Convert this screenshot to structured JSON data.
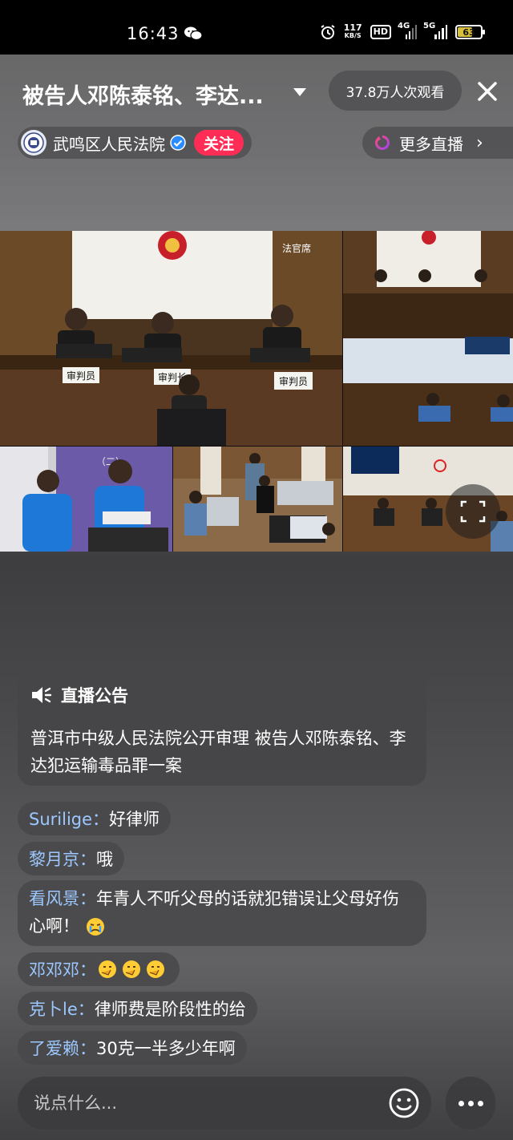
{
  "status_bar": {
    "time": "16:43",
    "speed_value": "117",
    "speed_unit": "KB/S",
    "hd": "HD",
    "network_4g": "4G",
    "network_5g": "5G",
    "battery": "63"
  },
  "header": {
    "title": "被告人邓陈泰铭、李达...",
    "viewers": "37.8万人次观看",
    "channel_name": "武鸣区人民法院",
    "follow_label": "关注",
    "more_live_label": "更多直播"
  },
  "video": {
    "judge_label_left": "审判员",
    "judge_label_center": "审判长",
    "judge_label_right": "审判员",
    "room_tag": "法官席",
    "cell_tag": "（二）"
  },
  "announcement": {
    "heading": "直播公告",
    "body": "普洱市中级人民法院公开审理 被告人邓陈泰铭、李达犯运输毒品罪一案"
  },
  "comments": [
    {
      "user": "Surilige：",
      "text": "好律师"
    },
    {
      "user": "黎月京：",
      "text": "哦"
    },
    {
      "user": "看风景：",
      "text": "年青人不听父母的话就犯错误让父母好伤心啊！"
    },
    {
      "user": "邓邓邓：",
      "text": ""
    },
    {
      "user": "克卜le：",
      "text": "律师费是阶段性的给"
    },
    {
      "user": "了爱赖：",
      "text": "30克一半多少年啊"
    }
  ],
  "input": {
    "placeholder": "说点什么..."
  },
  "colors": {
    "follow": "#ff2d55",
    "username": "#9cc8ff",
    "verified": "#2b8cff"
  }
}
